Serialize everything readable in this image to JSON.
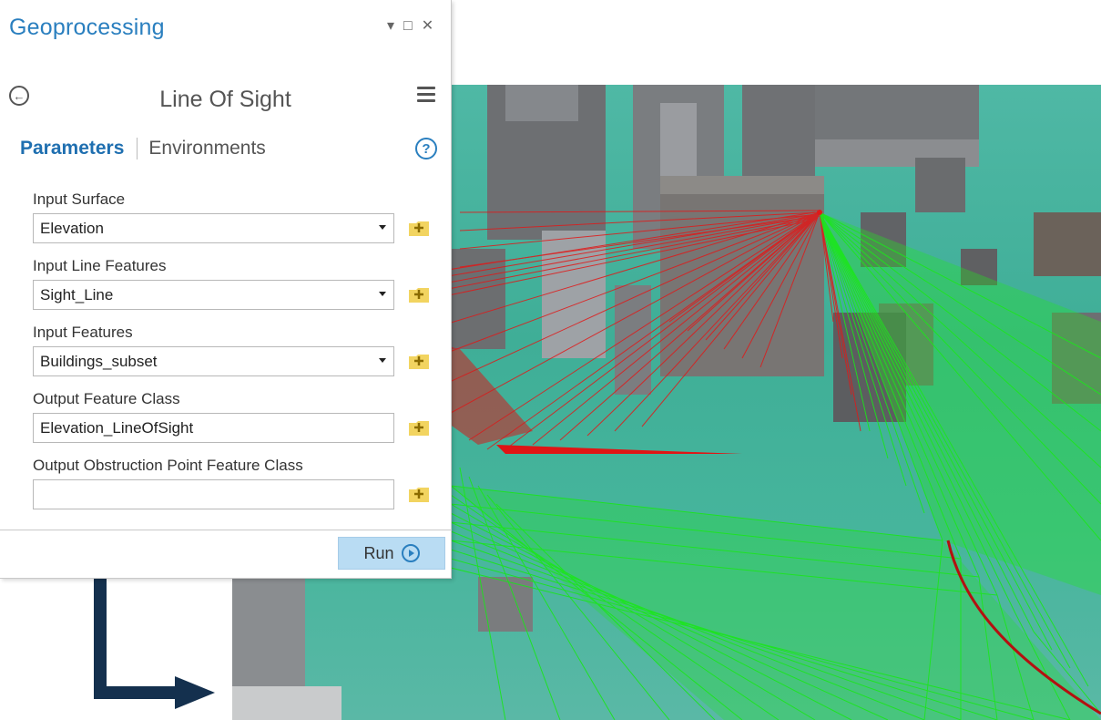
{
  "pane": {
    "title": "Geoprocessing",
    "window_controls": {
      "pin": "▾",
      "maximize": "□",
      "close": "✕"
    },
    "tool_title": "Line Of Sight",
    "tabs": {
      "parameters": "Parameters",
      "environments": "Environments"
    },
    "help": "?",
    "params": [
      {
        "label": "Input Surface",
        "value": "Elevation",
        "dropdown": true
      },
      {
        "label": "Input Line Features",
        "value": "Sight_Line",
        "dropdown": true
      },
      {
        "label": "Input Features",
        "value": "Buildings_subset",
        "dropdown": true
      },
      {
        "label": "Output Feature Class",
        "value": "Elevation_LineOfSight",
        "dropdown": false
      },
      {
        "label": "Output Obstruction Point Feature Class",
        "value": "",
        "dropdown": false
      }
    ],
    "run_label": "Run"
  },
  "colors": {
    "accent": "#2a7fbf",
    "tab_active": "#1f6fb0",
    "run_bg": "#b9dcf3",
    "arrow": "#14304e",
    "sight_visible": "#19e619",
    "sight_obstructed": "#e01919",
    "ground": "#45b39b"
  },
  "icons": [
    "back-arrow-icon",
    "hamburger-menu-icon",
    "help-icon",
    "browse-folder-icon",
    "dropdown-caret-icon",
    "run-play-icon",
    "pin-icon",
    "maximize-icon",
    "close-icon"
  ]
}
